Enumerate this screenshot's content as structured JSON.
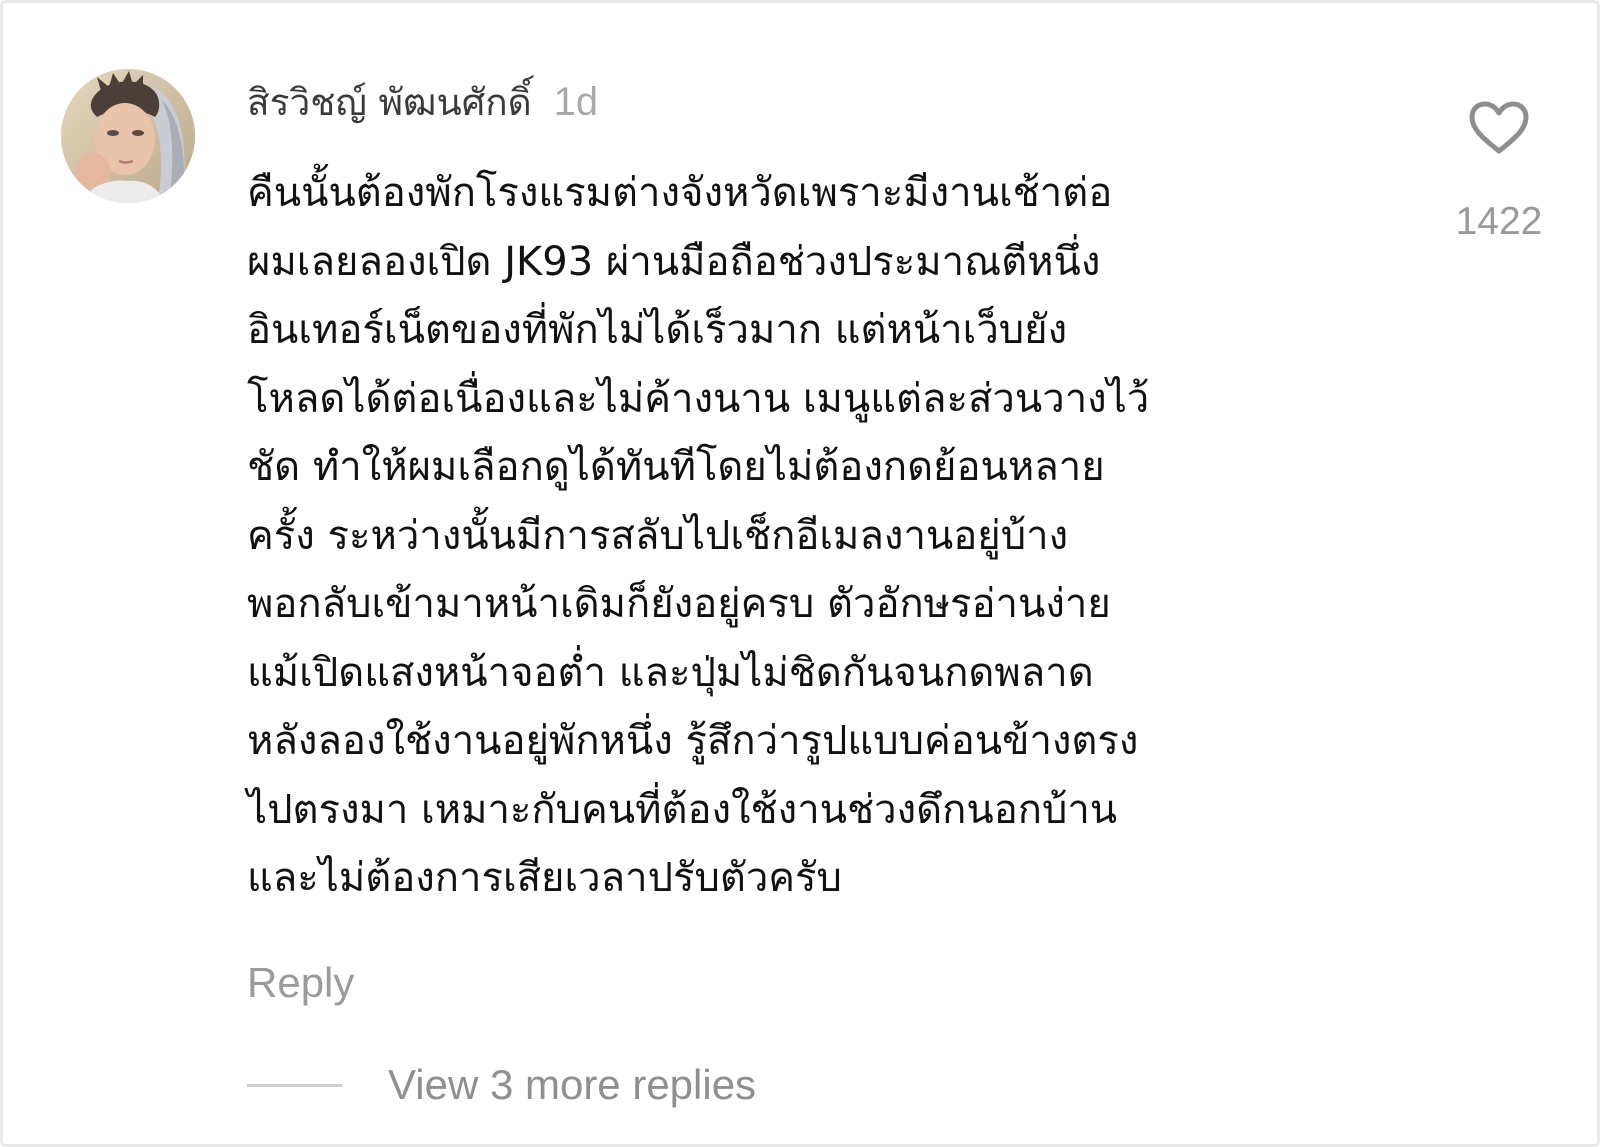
{
  "comment": {
    "username": "สิรวิชญ์ พัฒนศักดิ์",
    "time": "1d",
    "avatar": "user-avatar-photo",
    "lines": [
      "คืนนั้นต้องพักโรงแรมต่างจังหวัดเพราะมีงานเช้าต่อ",
      "ผมเลยลองเปิด JK93 ผ่านมือถือช่วงประมาณตีหนึ่ง",
      "อินเทอร์เน็ตของที่พักไม่ได้เร็วมาก แต่หน้าเว็บยัง",
      "โหลดได้ต่อเนื่องและไม่ค้างนาน เมนูแต่ละส่วนวางไว้",
      "ชัด ทำให้ผมเลือกดูได้ทันทีโดยไม่ต้องกดย้อนหลาย",
      "ครั้ง ระหว่างนั้นมีการสลับไปเช็กอีเมลงานอยู่บ้าง",
      "พอกลับเข้ามาหน้าเดิมก็ยังอยู่ครบ ตัวอักษรอ่านง่าย",
      "แม้เปิดแสงหน้าจอต่ำ และปุ่มไม่ชิดกันจนกดพลาด",
      "หลังลองใช้งานอยู่พักหนึ่ง รู้สึกว่ารูปแบบค่อนข้างตรง",
      "ไปตรงมา เหมาะกับคนที่ต้องใช้งานช่วงดึกนอกบ้าน",
      "และไม่ต้องการเสียเวลาปรับตัวครับ"
    ],
    "like_icon": "heart-outline-icon",
    "like_count": "1422",
    "reply_label": "Reply",
    "view_replies_label": "View 3 more replies"
  },
  "colors": {
    "username": "#3a3a3a",
    "timestamp": "#a8a8a8",
    "body_text": "#111111",
    "secondary": "#9b9b9b",
    "heart_stroke": "#8e8e8e",
    "divider": "#cfcfcf"
  }
}
